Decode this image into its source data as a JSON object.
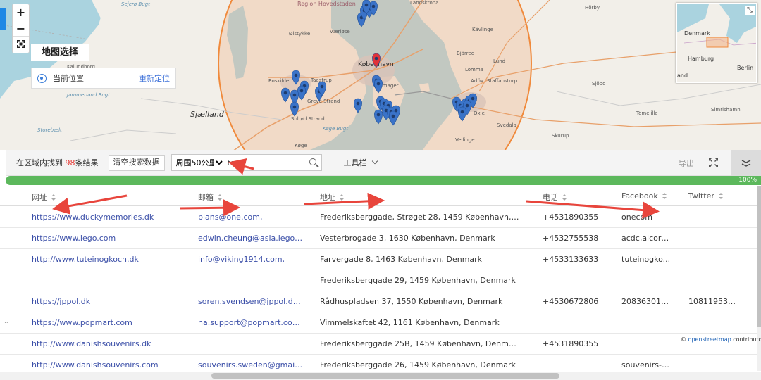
{
  "map": {
    "zoom_in": "+",
    "zoom_out": "−",
    "title": "地图选择",
    "current_location": "当前位置",
    "relocate": "重新定位",
    "labels": {
      "sejero_bugt": "Sejerø Bugt",
      "kalundborg": "Kalundborg",
      "jammerland_bugt": "Jammerland Bugt",
      "storebaelt": "Storebælt",
      "sjaelland": "Sjælland",
      "region": "Region Hovedstaden",
      "olstykke": "Ølstykke",
      "vaerlose": "Værløse",
      "kobenhavn": "København",
      "roskilde": "Roskilde",
      "taastrup": "Taastrup",
      "greve": "Greve Strand",
      "solrod": "Solrød Strand",
      "koge_bugt": "Køge Bugt",
      "koge": "Køge",
      "amager": "Amager",
      "landskrona": "Landskrona",
      "horby": "Hörby",
      "kavlinge": "Kävlinge",
      "bjarred": "Bjärred",
      "lund": "Lund",
      "lomma": "Lomma",
      "arlov": "Arlöv",
      "staffanstorp": "Staffanstorp",
      "sjobo": "Sjöbo",
      "oxie": "Oxie",
      "svedala": "Svedala",
      "tomelilla": "Tomelilla",
      "simrishamn": "Simrishamn",
      "skurup": "Skurup",
      "vellinge": "Vellinge",
      "mini_denmark": "Denmark",
      "mini_hamburg": "Hamburg",
      "mini_berlin": "Berlin",
      "mini_and": "and"
    }
  },
  "toolbar": {
    "found_prefix": "在区域内找到 ",
    "found_count": "98",
    "found_suffix": "条结果",
    "clear_button": "清空搜索数据",
    "radius_selected": "周围50公里",
    "search_value": "toys",
    "tools_label": "工具栏",
    "export_label": "导出"
  },
  "progress": {
    "value": 1.0,
    "label": "100%"
  },
  "table": {
    "headers": {
      "url": "网址",
      "email": "邮箱",
      "address": "地址",
      "phone": "电话",
      "facebook": "Facebook",
      "twitter": "Twitter"
    },
    "rows": [
      {
        "url": "https://www.duckymemories.dk",
        "email": "plans@one.com,",
        "address": "Frederiksberggade, Strøget 28, 1459 København, Den...",
        "phone": "+4531890355",
        "facebook": "onecom",
        "twitter": ""
      },
      {
        "url": "https://www.lego.com",
        "email": "edwin.cheung@asia.lego.c...",
        "address": "Vesterbrogade 3, 1630 København, Denmark",
        "phone": "+4532755538",
        "facebook": "acdc,alcord...",
        "twitter": ""
      },
      {
        "url": "http://www.tuteinogkoch.dk",
        "email": "info@viking1914.com,",
        "address": "Farvergade 8, 1463 København, Denmark",
        "phone": "+4533133633",
        "facebook": "tuteinogko...",
        "twitter": ""
      },
      {
        "url": "",
        "email": "",
        "address": "Frederiksberggade 29, 1459 København, Denmark",
        "phone": "",
        "facebook": "",
        "twitter": ""
      },
      {
        "url": "https://jppol.dk",
        "email": "soren.svendsen@jppol.dk,...",
        "address": "Rådhuspladsen 37, 1550 København, Denmark",
        "phone": "+4530672806",
        "facebook": "208363016...",
        "twitter": "108119537..."
      },
      {
        "url": "https://www.popmart.com",
        "email": "na.support@popmart.com...",
        "address": "Vimmelskaftet 42, 1161 København, Denmark",
        "phone": "",
        "facebook": "",
        "twitter": ""
      },
      {
        "url": "http://www.danishsouvenirs.dk",
        "email": "",
        "address": "Frederiksberggade 25B, 1459 København, Denmark",
        "phone": "+4531890355",
        "facebook": "",
        "twitter": ""
      },
      {
        "url": "http://www.danishsouvenirs.com",
        "email": "souvenirs.sweden@gmail....",
        "address": "Frederiksberggade 26, 1459 København, Denmark",
        "phone": "",
        "facebook": "souvenirs-s...",
        "twitter": ""
      }
    ],
    "row_ellipsis": ".."
  },
  "attribution": {
    "prefix": "© ",
    "link": "openstreetmap",
    "suffix": " contributors"
  },
  "colors": {
    "accent": "#3b6fd8",
    "count": "#e53935",
    "progress": "#5cb85c",
    "radius_circle": "#f08a3c",
    "radius_fill": "#f2b48a",
    "marker_blue": "#3a73c8",
    "marker_red": "#e0323a",
    "link": "#3b4fa8",
    "annotation_arrow": "#e8453c"
  },
  "icons": [
    "zoom-in-icon",
    "zoom-out-icon",
    "fit-bounds-icon",
    "location-icon",
    "search-icon",
    "chevron-down-icon",
    "export-icon",
    "fullscreen-icon",
    "collapse-icon",
    "sort-icon",
    "map-marker-icon",
    "minimap-toggle-icon"
  ]
}
